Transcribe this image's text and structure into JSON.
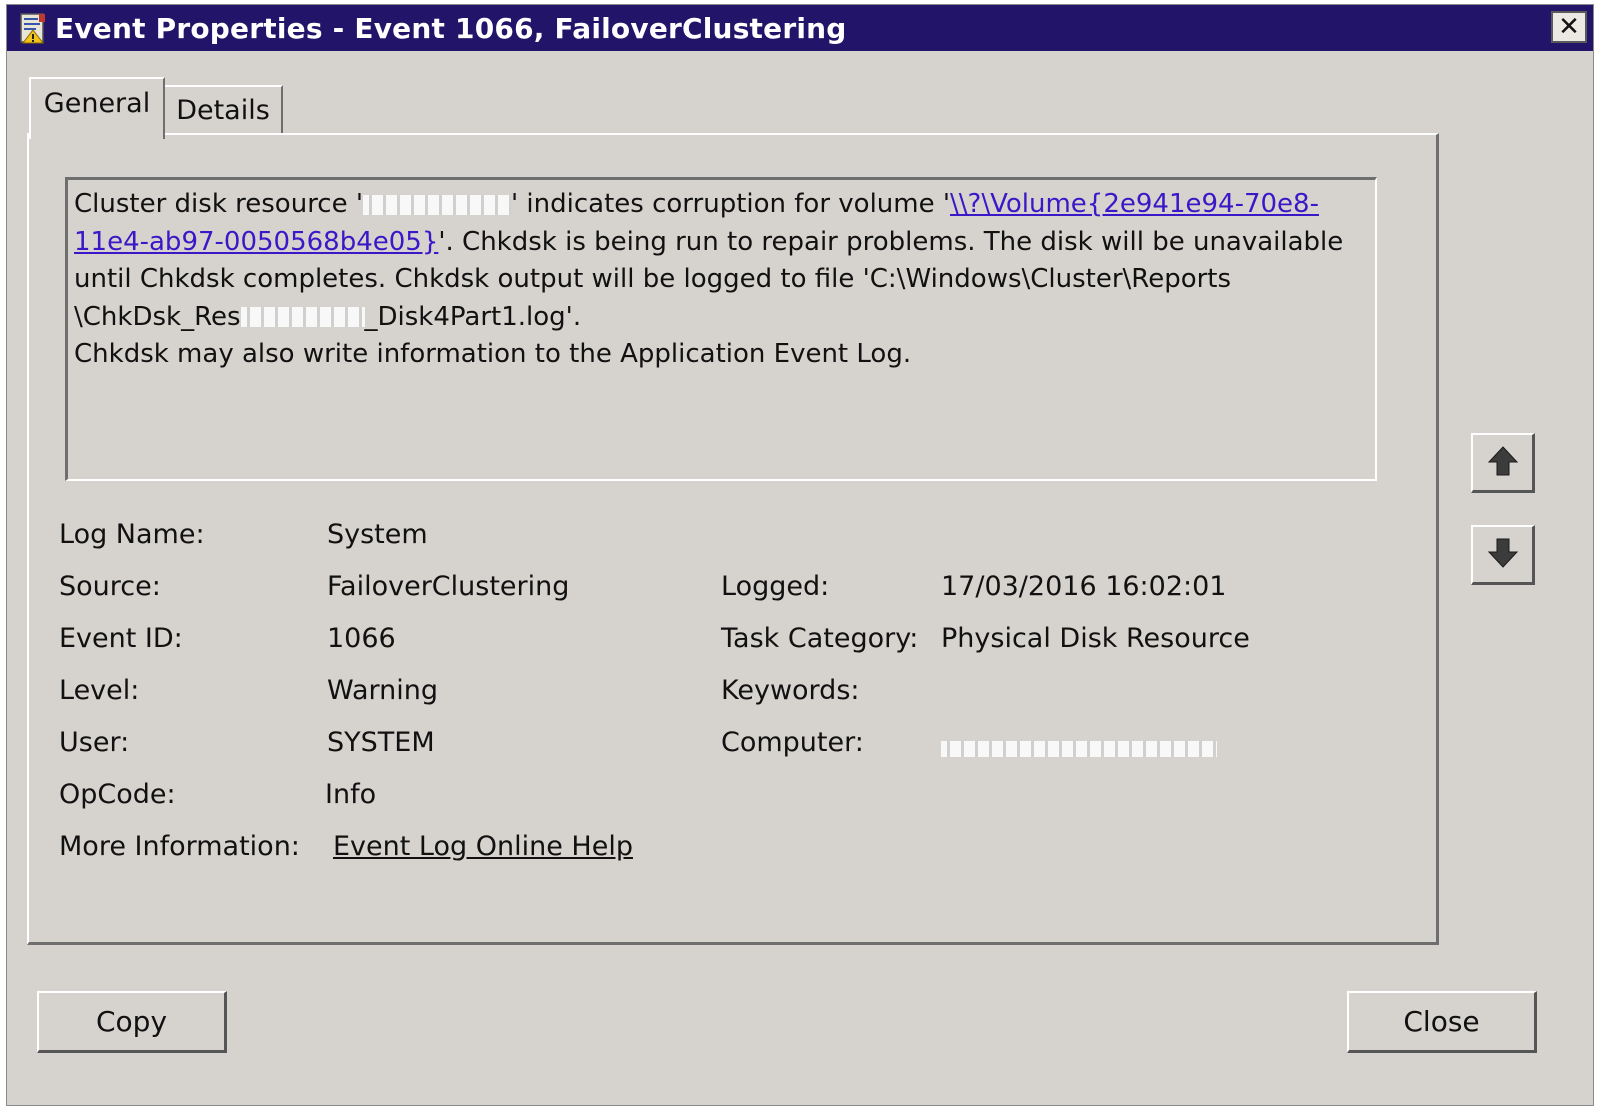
{
  "window": {
    "title": "Event Properties - Event 1066, FailoverClustering",
    "close_glyph": "✕"
  },
  "tabs": [
    {
      "label": "General",
      "active": true
    },
    {
      "label": "Details",
      "active": false
    }
  ],
  "message": {
    "part1": "Cluster disk resource '",
    "part2": "' indicates corruption for volume '",
    "volume_link_line1": "\\\\?\\Volume{2e941e94-70e8-",
    "volume_link_line2": "11e4-ab97-0050568b4e05}",
    "part3": "'. Chkdsk is being run to repair problems. The disk will be unavailable",
    "line3": "until Chkdsk completes. Chkdsk output will be logged to file 'C:\\Windows\\Cluster\\Reports",
    "line4a": "\\ChkDsk_Res",
    "line4b": "_Disk4Part1.log'.",
    "line5": " Chkdsk may also write information to the Application Event Log."
  },
  "properties": {
    "log_name_label": "Log Name:",
    "log_name_value": "System",
    "source_label": "Source:",
    "source_value": "FailoverClustering",
    "logged_label": "Logged:",
    "logged_value": "17/03/2016 16:02:01",
    "event_id_label": "Event ID:",
    "event_id_value": "1066",
    "task_category_label": "Task Category:",
    "task_category_value": "Physical Disk Resource",
    "level_label": "Level:",
    "level_value": "Warning",
    "keywords_label": "Keywords:",
    "user_label": "User:",
    "user_value": "SYSTEM",
    "computer_label": "Computer:",
    "opcode_label": "OpCode:",
    "opcode_value": "Info",
    "more_info_label": "More Information:",
    "more_info_link": "Event Log Online Help"
  },
  "buttons": {
    "copy_label": "Copy",
    "close_label": "Close"
  },
  "colors": {
    "titlebar": "#221469",
    "link": "#3a18c8",
    "dialog_bg": "#d6d3ce"
  },
  "icons": [
    "event-properties-icon",
    "close-icon",
    "arrow-up-icon",
    "arrow-down-icon"
  ]
}
